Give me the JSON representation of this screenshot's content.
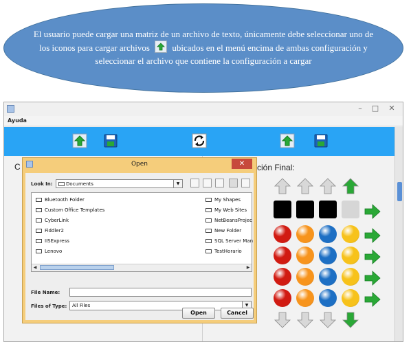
{
  "callout": {
    "text_before": "El usuario puede cargar una matriz de un archivo de texto, únicamente debe seleccionar uno de los iconos para cargar archivos",
    "text_after": "ubicados en el menú encima de ambas configuración y seleccionar el archivo que contiene la configuración a cargar",
    "icon": "load-file-icon"
  },
  "window": {
    "minimize_glyph": "–",
    "maximize_glyph": "□",
    "close_glyph": "✕",
    "menu": [
      "Ayuda"
    ]
  },
  "toolbar": {
    "left_icons": [
      "load-file-icon",
      "save-icon"
    ],
    "center_icon": "reset-icon",
    "right_icons": [
      "load-file-icon",
      "save-icon"
    ]
  },
  "panels": {
    "left_label": "C",
    "right_label": "ción Final:"
  },
  "grid": {
    "row1": [
      "arrow-up-gray-icon",
      "arrow-up-gray-icon",
      "arrow-up-gray-icon",
      "arrow-up-green-icon"
    ],
    "row2": [
      "black-square",
      "black-square",
      "black-square",
      "gray-square",
      "arrow-right-green-icon"
    ],
    "ball_rows": [
      [
        "red",
        "orange",
        "blue",
        "yellow"
      ],
      [
        "red",
        "orange",
        "blue",
        "yellow"
      ],
      [
        "red",
        "orange",
        "blue",
        "yellow"
      ],
      [
        "red",
        "orange",
        "blue",
        "yellow"
      ]
    ],
    "bottom": [
      "arrow-down-gray-icon",
      "arrow-down-gray-icon",
      "arrow-down-gray-icon",
      "arrow-down-green-icon"
    ],
    "colors": {
      "red": "#d11b12",
      "orange": "#f7941d",
      "blue": "#1d6fc4",
      "yellow": "#f7c21b",
      "green": "#2aa836"
    }
  },
  "dialog": {
    "title": "Open",
    "close_glyph": "✕",
    "look_in_label": "Look In:",
    "look_in_value": "Documents",
    "files_left": [
      "Bluetooth Folder",
      "Custom Office Templates",
      "CyberLink",
      "Fiddler2",
      "IISExpress",
      "Lenovo"
    ],
    "files_right": [
      "My Shapes",
      "My Web Sites",
      "NetBeansProjec",
      "New Folder",
      "SQL Server Man",
      "TestHorario"
    ],
    "file_name_label": "File Name:",
    "file_name_value": "",
    "file_type_label": "Files of Type:",
    "file_type_value": "All Files",
    "open_button": "Open",
    "cancel_button": "Cancel"
  }
}
